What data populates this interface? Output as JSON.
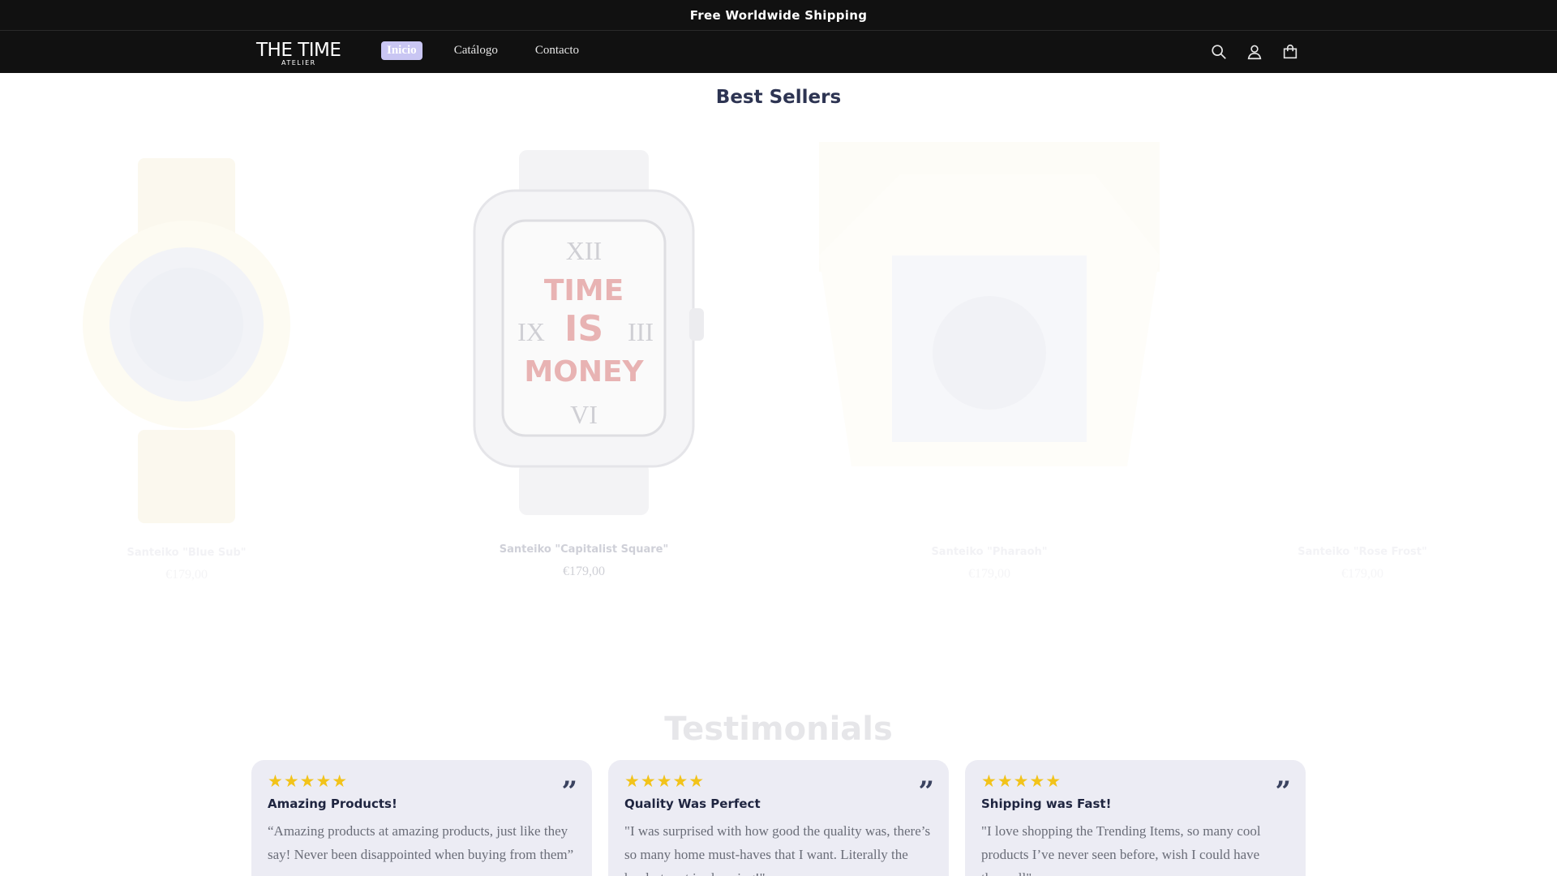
{
  "announcement": {
    "text": "Free Worldwide Shipping"
  },
  "header": {
    "logo": {
      "main": "THE TIME",
      "sub": "ATELIER"
    },
    "nav": [
      {
        "label": "Inicio",
        "active": true
      },
      {
        "label": "Catálogo",
        "active": false
      },
      {
        "label": "Contacto",
        "active": false
      }
    ],
    "icons": [
      "search-icon",
      "account-icon",
      "cart-icon"
    ]
  },
  "best_sellers": {
    "title": "Best Sellers",
    "products": [
      {
        "name": "Santeiko \"Blue Sub\"",
        "price": "€179,00"
      },
      {
        "name": "Santeiko \"Capitalist Square\"",
        "price": "€179,00"
      },
      {
        "name": "Santeiko \"Pharaoh\"",
        "price": "€179,00"
      },
      {
        "name": "Santeiko \"Rose Frost\"",
        "price": "€179,00"
      }
    ]
  },
  "testimonials": {
    "title": "Testimonials",
    "cards": [
      {
        "stars": "★★★★★",
        "title": "Amazing Products!",
        "text": "“Amazing products at amazing products, just like they say! Never been disappointed when buying from them”"
      },
      {
        "stars": "★★★★★",
        "title": "Quality Was Perfect",
        "text": "\"I was surprised with how good the quality was, there’s so many home must-haves that I want. Literally the hardest part is choosing!\""
      },
      {
        "stars": "★★★★★",
        "title": "Shipping was Fast!",
        "text": "\"I love shopping the Trending Items, so many cool products I’ve never seen before, wish I could have them all\""
      }
    ]
  },
  "colors": {
    "header_bg": "#111111",
    "nav_active": "#c9c6f3",
    "title": "#2d3452",
    "star": "#f2c31a",
    "card_bg": "#ececf4"
  }
}
